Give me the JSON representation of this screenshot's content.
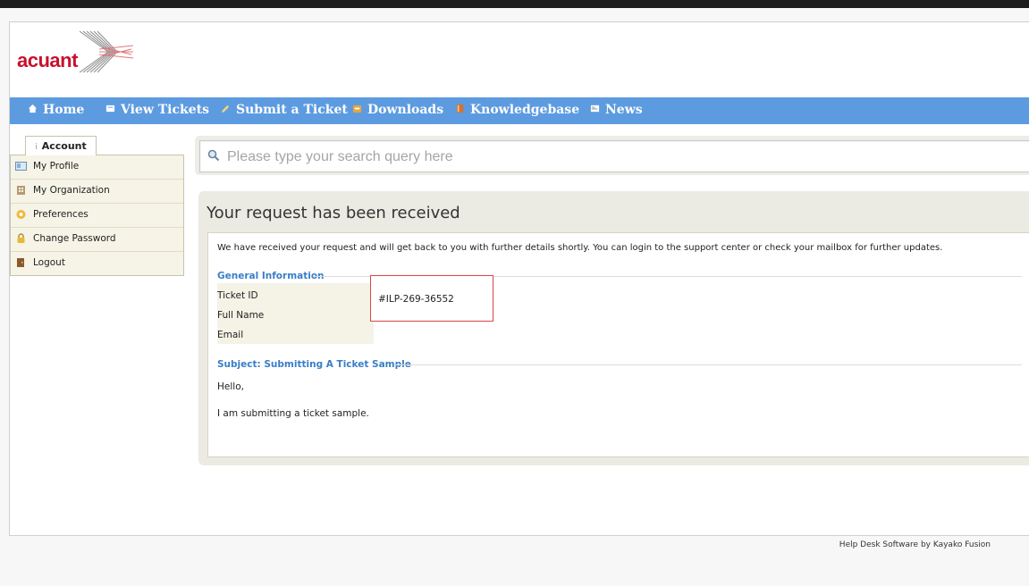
{
  "brand": {
    "logo_text": "acuant"
  },
  "nav": [
    {
      "label": "Home",
      "icon": "home-icon"
    },
    {
      "label": "View Tickets",
      "icon": "tickets-icon"
    },
    {
      "label": "Submit a Ticket",
      "icon": "pencil-icon"
    },
    {
      "label": "Downloads",
      "icon": "download-icon"
    },
    {
      "label": "Knowledgebase",
      "icon": "book-icon"
    },
    {
      "label": "News",
      "icon": "news-icon"
    }
  ],
  "sidebar": {
    "tab_label": "Account",
    "items": [
      {
        "label": "My Profile",
        "icon": "profile-icon"
      },
      {
        "label": "My Organization",
        "icon": "organization-icon"
      },
      {
        "label": "Preferences",
        "icon": "preferences-icon"
      },
      {
        "label": "Change Password",
        "icon": "lock-icon"
      },
      {
        "label": "Logout",
        "icon": "logout-icon"
      }
    ]
  },
  "search": {
    "placeholder": "Please type your search query here"
  },
  "panel": {
    "title": "Your request has been received",
    "intro": "We have received your request and will get back to you with further details shortly. You can login to the support center or check your mailbox for further updates.",
    "general_heading": "General Information",
    "fields": [
      {
        "label": "Ticket ID",
        "value": "#ILP-269-36552"
      },
      {
        "label": "Full Name",
        "value": ""
      },
      {
        "label": "Email",
        "value": ""
      }
    ],
    "subject_heading": "Subject: Submitting A Ticket Sample",
    "message_greeting": "Hello,",
    "message_body": "I am submitting a ticket sample."
  },
  "footer": {
    "text": "Help Desk Software by Kayako Fusion"
  },
  "colors": {
    "nav_bg": "#5d9be0",
    "brand_red": "#c8102e",
    "section_blue": "#3a7ec6",
    "highlight_border": "#d9464a"
  }
}
